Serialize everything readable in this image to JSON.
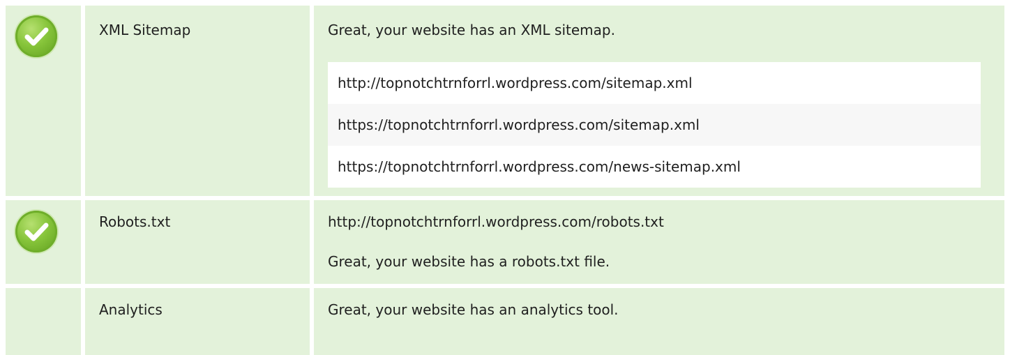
{
  "rows": [
    {
      "label": "XML Sitemap",
      "status": "check",
      "message": "Great, your website has an XML sitemap.",
      "urls": [
        "http://topnotchtrnforrl.wordpress.com/sitemap.xml",
        "https://topnotchtrnforrl.wordpress.com/sitemap.xml",
        "https://topnotchtrnforrl.wordpress.com/news-sitemap.xml"
      ]
    },
    {
      "label": "Robots.txt",
      "status": "check",
      "url": "http://topnotchtrnforrl.wordpress.com/robots.txt",
      "message": "Great, your website has a robots.txt file."
    },
    {
      "label": "Analytics",
      "status": "none",
      "message": "Great, your website has an analytics tool."
    }
  ],
  "colors": {
    "cell_background": "#e3f2da",
    "check_green": "#86c43a"
  }
}
